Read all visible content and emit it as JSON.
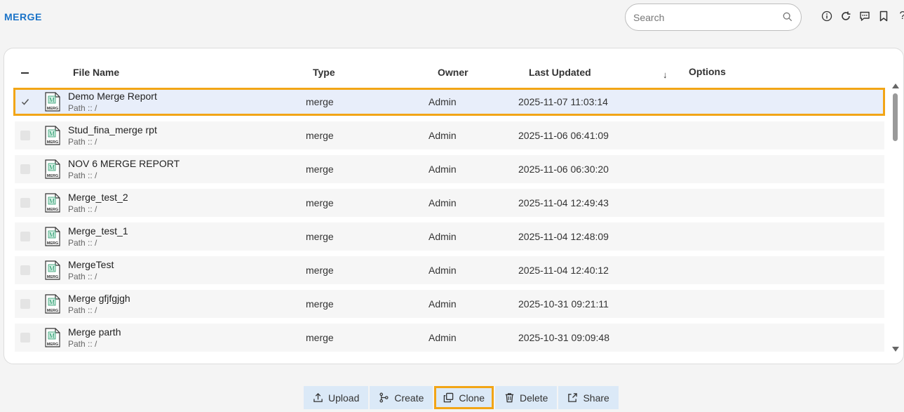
{
  "app": {
    "title": "MERGE"
  },
  "search": {
    "placeholder": "Search",
    "value": ""
  },
  "header_icons": [
    "info-icon",
    "refresh-icon",
    "comment-icon",
    "bookmark-icon",
    "help-icon"
  ],
  "table": {
    "columns": {
      "file_name": "File Name",
      "type": "Type",
      "owner": "Owner",
      "last_updated": "Last Updated",
      "sort_indicator": "↓",
      "options": "Options"
    },
    "rows": [
      {
        "name": "Demo Merge Report",
        "path": "Path :: /",
        "type": "merge",
        "owner": "Admin",
        "updated": "2025-11-07 11:03:14",
        "selected": true
      },
      {
        "name": "Stud_fina_merge rpt",
        "path": "Path :: /",
        "type": "merge",
        "owner": "Admin",
        "updated": "2025-11-06 06:41:09",
        "selected": false
      },
      {
        "name": "NOV 6 MERGE REPORT",
        "path": "Path :: /",
        "type": "merge",
        "owner": "Admin",
        "updated": "2025-11-06 06:30:20",
        "selected": false
      },
      {
        "name": "Merge_test_2",
        "path": "Path :: /",
        "type": "merge",
        "owner": "Admin",
        "updated": "2025-11-04 12:49:43",
        "selected": false
      },
      {
        "name": "Merge_test_1",
        "path": "Path :: /",
        "type": "merge",
        "owner": "Admin",
        "updated": "2025-11-04 12:48:09",
        "selected": false
      },
      {
        "name": "MergeTest",
        "path": "Path :: /",
        "type": "merge",
        "owner": "Admin",
        "updated": "2025-11-04 12:40:12",
        "selected": false
      },
      {
        "name": "Merge gfjfgjgh",
        "path": "Path :: /",
        "type": "merge",
        "owner": "Admin",
        "updated": "2025-10-31 09:21:11",
        "selected": false
      },
      {
        "name": "Merge parth",
        "path": "Path :: /",
        "type": "merge",
        "owner": "Admin",
        "updated": "2025-10-31 09:09:48",
        "selected": false
      }
    ]
  },
  "doc_icon": {
    "badge": "MERG",
    "letter": "M"
  },
  "toolbar": {
    "upload": "Upload",
    "create": "Create",
    "clone": "Clone",
    "delete": "Delete",
    "share": "Share"
  },
  "colors": {
    "accent": "#1a73c8",
    "highlight": "#f2a516",
    "button_bg": "#dbe9f7",
    "selected_row": "#e8eefa"
  }
}
